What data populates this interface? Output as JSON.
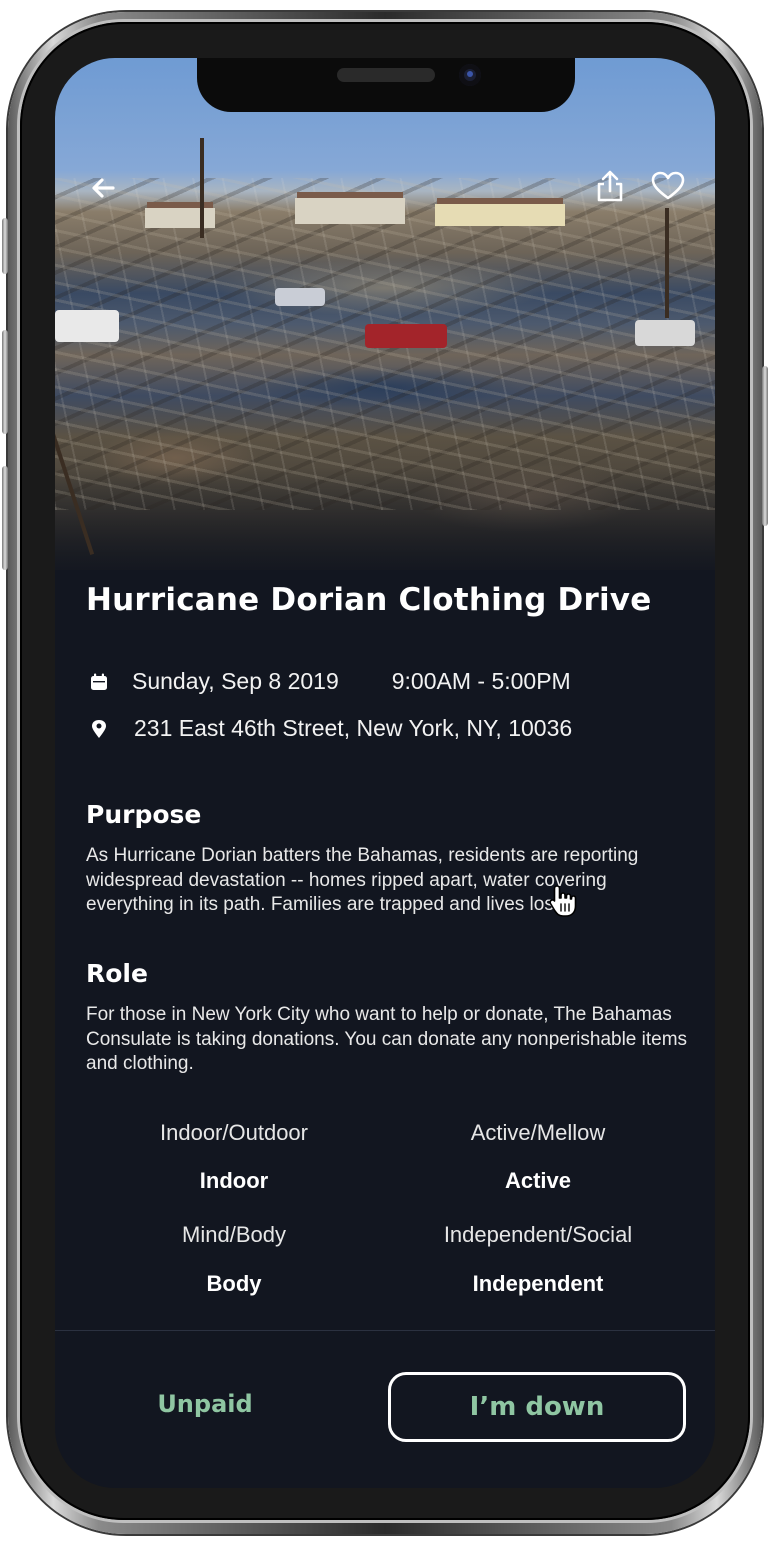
{
  "event": {
    "title": "Hurricane Dorian Clothing Drive",
    "date": "Sunday, Sep 8 2019",
    "time": "9:00AM - 5:00PM",
    "address": "231 East 46th Street, New York, NY, 10036"
  },
  "purpose": {
    "heading": "Purpose",
    "text": "As Hurricane Dorian batters the Bahamas, residents are reporting widespread devastation -- homes ripped apart, water covering everything in its path. Families are trapped and lives lost."
  },
  "role": {
    "heading": "Role",
    "text": "For those in New York City who want to help or donate, The Bahamas Consulate is taking donations. You can donate any nonperishable items and clothing."
  },
  "attributes": [
    {
      "label": "Indoor/Outdoor",
      "value": "Indoor"
    },
    {
      "label": "Active/Mellow",
      "value": "Active"
    },
    {
      "label": "Mind/Body",
      "value": "Body"
    },
    {
      "label": "Independent/Social",
      "value": "Independent"
    }
  ],
  "footer": {
    "payment_label": "Unpaid",
    "cta_label": "I’m down"
  },
  "icons": {
    "back": "arrow-left-icon",
    "share": "share-icon",
    "favorite": "heart-icon",
    "date": "calendar-icon",
    "location": "location-pin-icon"
  },
  "colors": {
    "background": "#121620",
    "accent_green": "#8fc6a2",
    "text": "#ffffff"
  }
}
